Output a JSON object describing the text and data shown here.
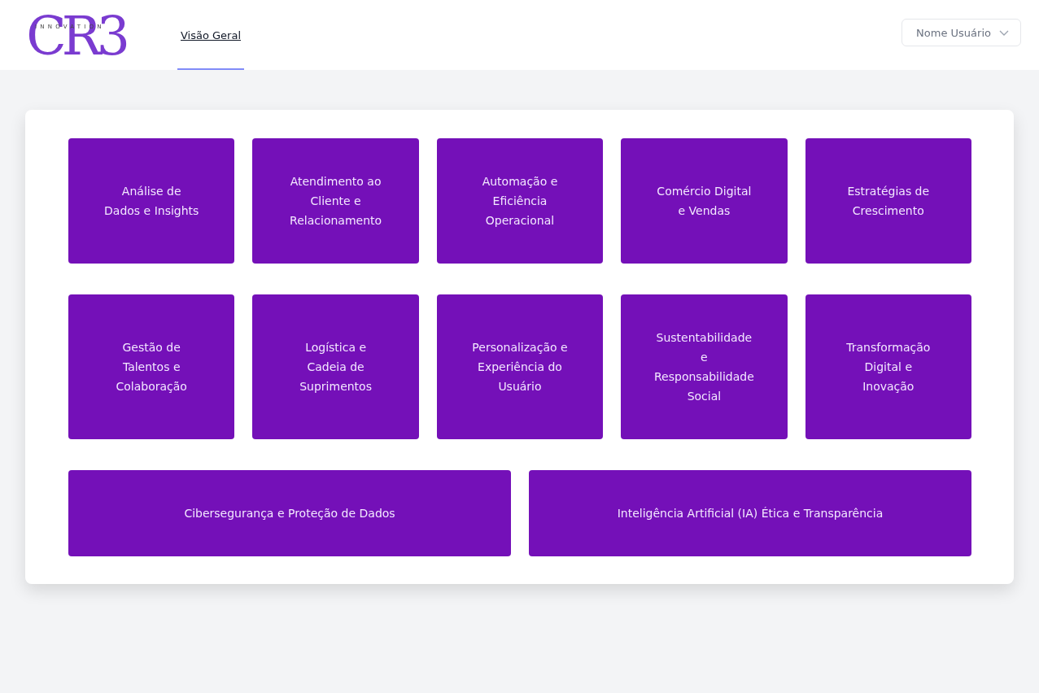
{
  "header": {
    "logo": {
      "mark": "CR3",
      "tagline": "INNOVATION"
    },
    "tabs": [
      {
        "label": "Visão Geral",
        "selected": true
      }
    ],
    "user_menu": {
      "label": "Nome Usuário"
    }
  },
  "tiles": [
    {
      "title_lines": [
        "Análise de",
        "Dados e Insights"
      ]
    },
    {
      "title_lines": [
        "Atendimento ao",
        "Cliente e",
        "Relacionamento"
      ]
    },
    {
      "title_lines": [
        "Automação e",
        "Eficiência",
        "Operacional"
      ]
    },
    {
      "title_lines": [
        "Comércio Digital",
        "e Vendas"
      ]
    },
    {
      "title_lines": [
        "Estratégias de",
        "Crescimento"
      ]
    },
    {
      "title_lines": [
        "Gestão de",
        "Talentos e",
        "Colaboração"
      ]
    },
    {
      "title_lines": [
        "Logística e",
        "Cadeia de",
        "Suprimentos"
      ]
    },
    {
      "title_lines": [
        "Personalização e",
        "Experiência do",
        "Usuário"
      ]
    },
    {
      "title_lines": [
        "Sustentabilidade",
        "e",
        "Responsabilidade",
        "Social"
      ]
    },
    {
      "title_lines": [
        "Transformação",
        "Digital e",
        "Inovação"
      ]
    }
  ],
  "wide_tiles": [
    {
      "title_lines": [
        "Cibersegurança e Proteção de Dados"
      ]
    },
    {
      "title_lines": [
        "Inteligência Artificial (IA) Ética e Transparência"
      ]
    }
  ]
}
